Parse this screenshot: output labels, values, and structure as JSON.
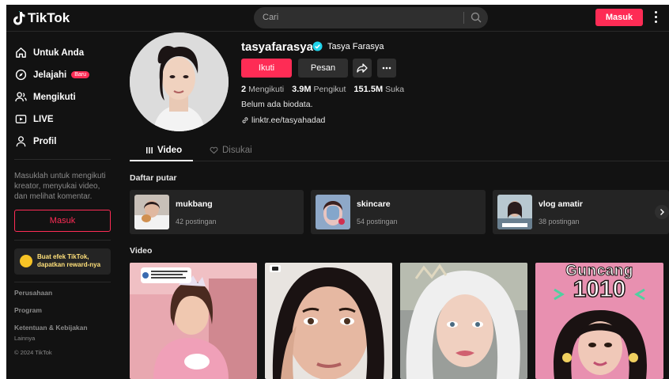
{
  "header": {
    "brand": "TikTok",
    "search_placeholder": "Cari",
    "login_label": "Masuk"
  },
  "sidebar": {
    "items": [
      {
        "label": "Untuk Anda",
        "icon": "home-icon"
      },
      {
        "label": "Jelajahi",
        "icon": "compass-icon",
        "badge": "Baru"
      },
      {
        "label": "Mengikuti",
        "icon": "users-icon"
      },
      {
        "label": "LIVE",
        "icon": "live-icon"
      },
      {
        "label": "Profil",
        "icon": "profile-icon"
      }
    ],
    "login_hint": "Masuklah untuk mengikuti kreator, menyukai video, dan melihat komentar.",
    "login_label": "Masuk",
    "effect_line1": "Buat efek TikTok,",
    "effect_line2": "dapatkan reward-nya",
    "footer": {
      "company": "Perusahaan",
      "program": "Program",
      "terms": "Ketentuan & Kebijakan",
      "more": "Lainnya",
      "copyright": "© 2024 TikTok"
    }
  },
  "profile": {
    "username": "tasyafarasya",
    "display_name": "Tasya Farasya",
    "follow_label": "Ikuti",
    "message_label": "Pesan",
    "following_count": "2",
    "following_label": "Mengikuti",
    "followers_count": "3.9M",
    "followers_label": "Pengikut",
    "likes_count": "151.5M",
    "likes_label": "Suka",
    "bio": "Belum ada biodata.",
    "link": "linktr.ee/tasyahadad"
  },
  "tabs": {
    "videos": "Video",
    "liked": "Disukai"
  },
  "playlists": {
    "title": "Daftar putar",
    "items": [
      {
        "name": "mukbang",
        "count": "42 postingan"
      },
      {
        "name": "skincare",
        "count": "54 postingan"
      },
      {
        "name": "vlog amatir",
        "count": "38 postingan"
      }
    ]
  },
  "videos": {
    "title": "Video",
    "overlay_text": "Guncang",
    "overlay_number": "1010"
  },
  "colors": {
    "accent": "#fe2c55",
    "background": "#121212",
    "card": "#242424",
    "verified": "#20d5ec"
  }
}
